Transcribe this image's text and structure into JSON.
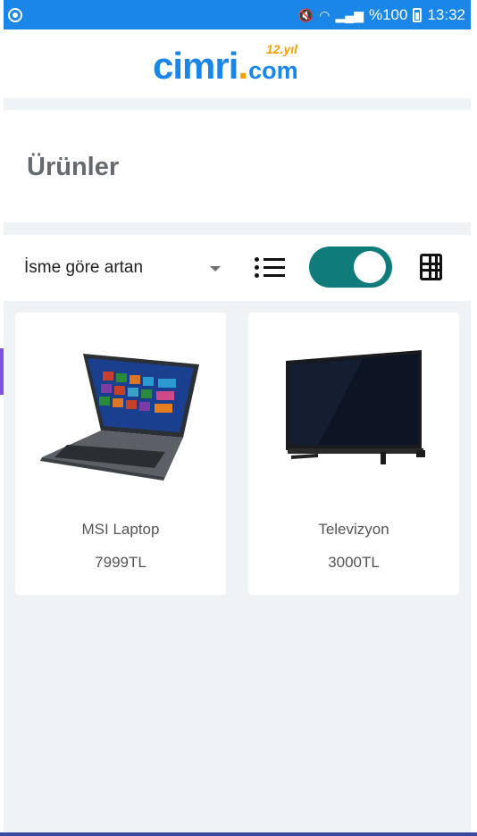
{
  "status_bar": {
    "battery_percent": "%100",
    "time": "13:32",
    "icons": [
      "app-icon",
      "mute-icon",
      "wifi-icon",
      "signal-icon",
      "battery-charging-icon"
    ]
  },
  "header": {
    "logo_main": "cimri",
    "logo_dot": ".",
    "logo_suffix": "com",
    "logo_badge": "12.yıl",
    "brand_color": "#1a86e8",
    "accent_color": "#f4a100"
  },
  "page": {
    "title": "Ürünler"
  },
  "controls": {
    "sort_value": "İsme göre artan",
    "view_toggle_on": true,
    "toggle_color": "#0f7b7b"
  },
  "products": [
    {
      "name": "MSI Laptop",
      "price": "7999TL",
      "image_icon": "laptop-image"
    },
    {
      "name": "Televizyon",
      "price": "3000TL",
      "image_icon": "tv-image"
    }
  ]
}
